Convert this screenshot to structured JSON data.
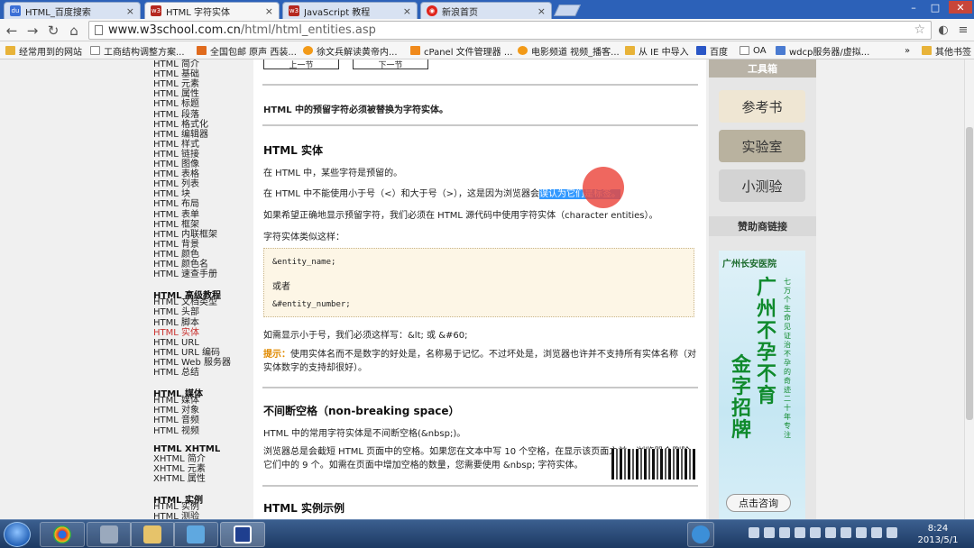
{
  "tabs": [
    {
      "label": "HTML_百度搜索",
      "color": "#3b6fd6",
      "glyph": "du"
    },
    {
      "label": "HTML 字符实体",
      "color": "#b5281f",
      "glyph": "w3",
      "active": true
    },
    {
      "label": "JavaScript 教程",
      "color": "#b5281f",
      "glyph": "w3"
    },
    {
      "label": "新浪首页",
      "color": "#e0241b",
      "glyph": "sina"
    }
  ],
  "window_controls": {
    "minimize": "–",
    "maximize": "□",
    "close": "✕"
  },
  "nav": {
    "back": "←",
    "forward": "→",
    "reload": "↻",
    "home": "⌂"
  },
  "address": {
    "domain": "www.w3school.com.cn",
    "path": "/html/html_entities.asp",
    "star": "☆"
  },
  "bookmarks": [
    {
      "label": "经常用到的网站",
      "icon": "folder"
    },
    {
      "label": "工商结构调整方案...",
      "icon": "page"
    },
    {
      "label": "全国包邮 原声 西装...",
      "icon": "tmall"
    },
    {
      "label": "徐文兵解读黄帝内...",
      "icon": "orange"
    },
    {
      "label": "cPanel 文件管理器 ...",
      "icon": "cpanel"
    },
    {
      "label": "电影频道 视频_播客...",
      "icon": "orange"
    },
    {
      "label": "从 IE 中导入",
      "icon": "folder"
    },
    {
      "label": "百度",
      "icon": "baidu"
    },
    {
      "label": "OA",
      "icon": "page"
    },
    {
      "label": "wdcp服务器/虚拟...",
      "icon": "wdcp"
    },
    {
      "label": "»",
      "icon": "none"
    },
    {
      "label": "其他书签",
      "icon": "folder"
    }
  ],
  "sidebar": {
    "basic_items": [
      "HTML 简介",
      "HTML 基础",
      "HTML 元素",
      "HTML 属性",
      "HTML 标题",
      "HTML 段落",
      "HTML 格式化",
      "HTML 编辑器",
      "HTML 样式",
      "HTML 链接",
      "HTML 图像",
      "HTML 表格",
      "HTML 列表",
      "HTML 块",
      "HTML 布局",
      "HTML 表单",
      "HTML 框架",
      "HTML 内联框架",
      "HTML 背景",
      "HTML 颜色",
      "HTML 颜色名",
      "HTML 速查手册"
    ],
    "advanced_head": "HTML 高级教程",
    "advanced_items": [
      "HTML 文档类型",
      "HTML 头部",
      "HTML 脚本",
      "HTML 实体",
      "HTML URL",
      "HTML URL 编码",
      "HTML Web 服务器",
      "HTML 总结"
    ],
    "current_index": 3,
    "media_head": "HTML 媒体",
    "media_items": [
      "HTML 媒体",
      "HTML 对象",
      "HTML 音频",
      "HTML 视频"
    ],
    "xhtml_head": "HTML XHTML",
    "xhtml_items": [
      "XHTML 简介",
      "XHTML 元素",
      "XHTML 属性"
    ],
    "examples_head": "HTML 实例",
    "examples_items": [
      "HTML 实例",
      "HTML 测验"
    ]
  },
  "content": {
    "prev_label": "上一节",
    "next_label": "下一节",
    "intro": "HTML 中的预留字符必须被替换为字符实体。",
    "h_entities": "HTML 实体",
    "p1": "在 HTML 中，某些字符是预留的。",
    "p2_before": "在 HTML 中不能使用小于号（<）和大于号（>），这是因为浏览器会",
    "p2_highlight": "误认为它们是标签。",
    "p3": "如果希望正确地显示预留字符，我们必须在 HTML 源代码中使用字符实体（character entities）。",
    "p4": "字符实体类似这样：",
    "code1": "&entity_name;",
    "code_or": "或者",
    "code2": "&#entity_number;",
    "p5": "如需显示小于号，我们必须这样写：&lt; 或 &#60;",
    "tip_label": "提示：",
    "tip_text": "使用实体名而不是数字的好处是，名称易于记忆。不过坏处是，浏览器也许并不支持所有实体名称（对实体数字的支持却很好）。",
    "h_nbsp": "不间断空格（non-breaking space）",
    "p6": "HTML 中的常用字符实体是不间断空格(&nbsp;)。",
    "p7": "浏览器总是会截短 HTML 页面中的空格。如果您在文本中写 10 个空格，在显示该页面之前，浏览器会删除它们中的 9 个。如需在页面中增加空格的数量，您需要使用 &nbsp; 字符实体。",
    "h_examples": "HTML 实例示例"
  },
  "toolbox": {
    "head": "工具箱",
    "btn1": "参考书",
    "btn2": "实验室",
    "btn3": "小测验",
    "sponsor": "赞助商链接"
  },
  "ad": {
    "logo": "广州长安医院",
    "big1": "广州不孕不育",
    "big2": "金字招牌",
    "side": "七万个生命见证治不孕的奇迹二十年专注",
    "button": "点击咨询"
  },
  "clock": {
    "time": "8:24",
    "date": "2013/5/1"
  }
}
